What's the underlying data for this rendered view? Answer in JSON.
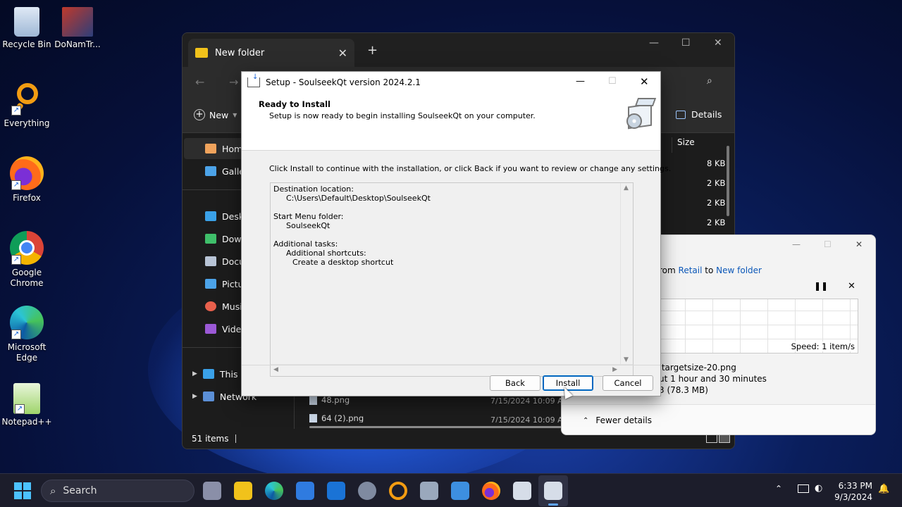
{
  "desktop": {
    "icons": [
      {
        "label": "Recycle Bin"
      },
      {
        "label": "DoNamTr..."
      },
      {
        "label": "Everything"
      },
      {
        "label": "Firefox"
      },
      {
        "label": "Google Chrome"
      },
      {
        "label": "Microsoft Edge"
      },
      {
        "label": "Notepad++"
      }
    ]
  },
  "explorer": {
    "tab_title": "New folder",
    "new_label": "New",
    "details_label": "Details",
    "column_size": "Size",
    "sizes": [
      "8 KB",
      "2 KB",
      "2 KB",
      "2 KB"
    ],
    "sidebar": [
      {
        "label": "Home"
      },
      {
        "label": "Galler"
      },
      {
        "label": "Deskt"
      },
      {
        "label": "Down"
      },
      {
        "label": "Docu"
      },
      {
        "label": "Pictur"
      },
      {
        "label": "Music"
      },
      {
        "label": "Video"
      },
      {
        "label": "This P"
      },
      {
        "label": "Network"
      }
    ],
    "files": [
      {
        "name": "48.png",
        "date": "7/15/2024 10:09 AM"
      },
      {
        "name": "64 (2).png",
        "date": "7/15/2024 10:09 AM"
      }
    ],
    "status": "51 items"
  },
  "copy_dialog": {
    "from_prefix": "rom",
    "source": "Retail",
    "to_word": "to",
    "destination": "New folder",
    "speed": "Speed: 1 item/s",
    "name_line": ".targetsize-20.png",
    "time_line": "ut 1 hour and 30 minutes",
    "items_line": "3 (78.3 MB)",
    "fewer_details": "Fewer details",
    "progress": 0.0
  },
  "setup": {
    "title": "Setup - SoulseekQt version 2024.2.1",
    "heading": "Ready to Install",
    "subheading": "Setup is now ready to begin installing SoulseekQt on your computer.",
    "instruction": "Click Install to continue with the installation, or click Back if you want to review or change any settings.",
    "memo": {
      "dest_label": "Destination location:",
      "dest_value": "C:\\Users\\Default\\Desktop\\SoulseekQt",
      "menu_label": "Start Menu folder:",
      "menu_value": "SoulseekQt",
      "tasks_label": "Additional tasks:",
      "tasks_group": "Additional shortcuts:",
      "tasks_item": "Create a desktop shortcut"
    },
    "buttons": {
      "back": "Back",
      "install": "Install",
      "cancel": "Cancel"
    }
  },
  "taskbar": {
    "search_placeholder": "Search",
    "time": "6:33 PM",
    "date": "9/3/2024"
  },
  "colors": {
    "accent": "#0067c0",
    "link": "#0b57b8",
    "taskbar_bg": "#1c1d2b"
  }
}
